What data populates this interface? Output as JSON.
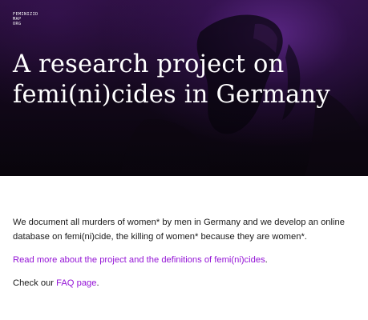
{
  "site": {
    "logo_lines": [
      "FEMINIZID",
      "MAP",
      "ORG"
    ]
  },
  "hero": {
    "title_lines": [
      "A research project on",
      "femi(ni)cides in Germany"
    ]
  },
  "intro": {
    "lines": [
      "We document all murders of women* by men in Germany and we develop an online",
      "database on femi(ni)cide, the killing of women* because they are women*."
    ]
  },
  "links": {
    "project_link": "Read more about the project and the definitions of femi(ni)cides",
    "project_suffix": ".",
    "faq_prefix": "Check our ",
    "faq_link": "FAQ page",
    "faq_suffix": "."
  },
  "colors": {
    "link": "#9414d6",
    "hero_background": "#170a22",
    "accent_purple": "#692d9b"
  }
}
